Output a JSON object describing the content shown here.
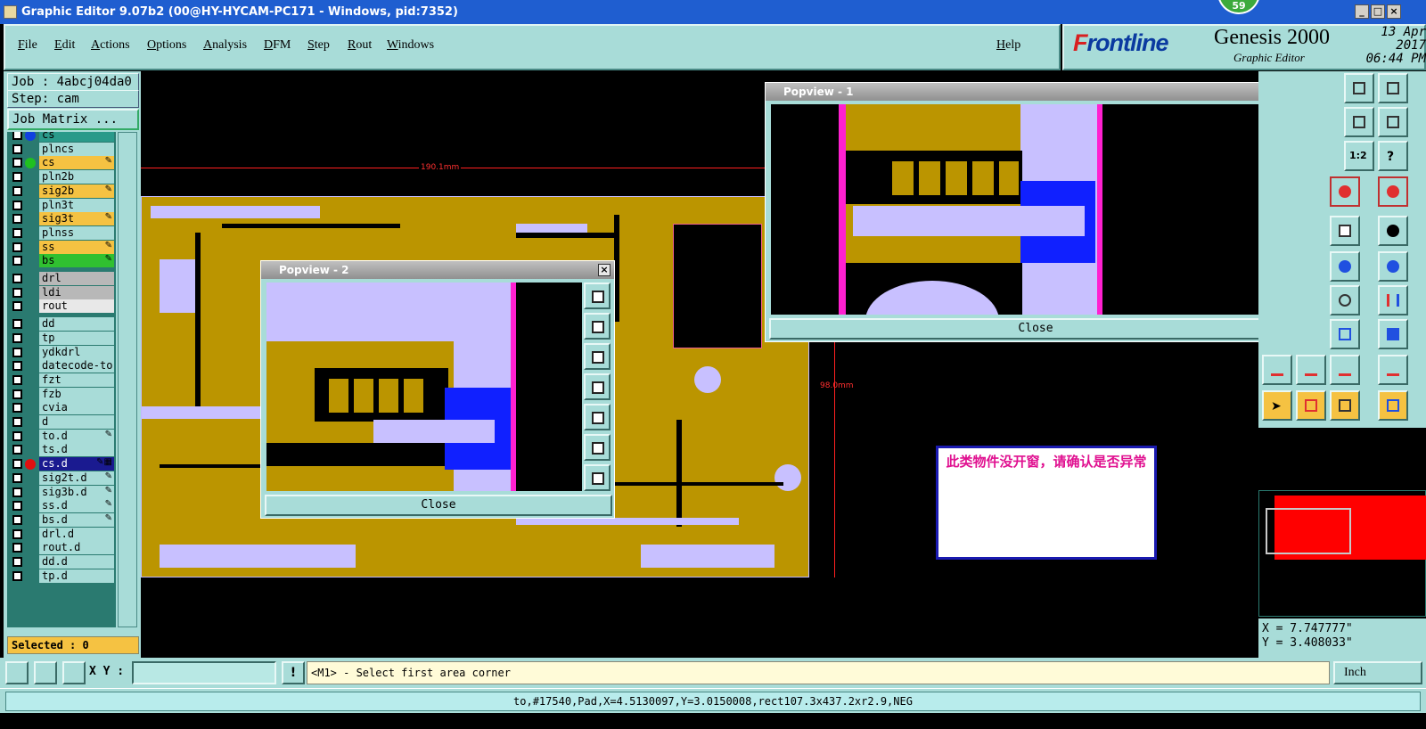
{
  "window": {
    "title": "Graphic Editor 9.07b2 (00@HY-HYCAM-PC171 - Windows, pid:7352)",
    "badge": "59"
  },
  "menu": [
    "File",
    "Edit",
    "Actions",
    "Options",
    "Analysis",
    "DFM",
    "Step",
    "Rout",
    "Windows"
  ],
  "help_label": "Help",
  "brand": {
    "logo_f": "F",
    "logo_rest": "rontline",
    "product": "Genesis 2000",
    "subtitle": "Graphic Editor",
    "date": "13 Apr 2017",
    "time": "06:44 PM"
  },
  "job": {
    "job_label": "Job : 4abcj04da0",
    "step_label": "Step: cam",
    "matrix_button": "Job Matrix ..."
  },
  "layers": [
    {
      "name": "cs",
      "color": "#2a9a8a",
      "dot": "#1040e0"
    },
    {
      "name": "plncs",
      "color": "#a8dcd8"
    },
    {
      "name": "cs",
      "color": "#f5c242",
      "dot": "#20c020",
      "mark": "✎"
    },
    {
      "name": "pln2b",
      "color": "#a8dcd8"
    },
    {
      "name": "sig2b",
      "color": "#f5c242",
      "mark": "✎"
    },
    {
      "name": "pln3t",
      "color": "#a8dcd8"
    },
    {
      "name": "sig3t",
      "color": "#f5c242",
      "mark": "✎"
    },
    {
      "name": "plnss",
      "color": "#a8dcd8"
    },
    {
      "name": "ss",
      "color": "#f5c242",
      "mark": "✎"
    },
    {
      "name": "bs",
      "color": "#30c030",
      "mark": "✎"
    },
    {
      "name": "drl",
      "color": "#b8b8b8"
    },
    {
      "name": "ldi",
      "color": "#b8b8b8"
    },
    {
      "name": "rout",
      "color": "#e8e8e8"
    },
    {
      "name": "dd",
      "color": "#a8dcd8"
    },
    {
      "name": "tp",
      "color": "#a8dcd8"
    },
    {
      "name": "ydkdrl",
      "color": "#a8dcd8"
    },
    {
      "name": "datecode-to",
      "color": "#a8dcd8"
    },
    {
      "name": "fzt",
      "color": "#a8dcd8"
    },
    {
      "name": "fzb",
      "color": "#a8dcd8"
    },
    {
      "name": "cvia",
      "color": "#a8dcd8"
    },
    {
      "name": "d",
      "color": "#a8dcd8"
    },
    {
      "name": "to.d",
      "color": "#a8dcd8",
      "mark": "✎"
    },
    {
      "name": "ts.d",
      "color": "#a8dcd8"
    },
    {
      "name": "cs.d",
      "color": "#1a1a90",
      "dot": "#e01010",
      "mark": "✎▦",
      "text": "#fff"
    },
    {
      "name": "sig2t.d",
      "color": "#a8dcd8",
      "mark": "✎"
    },
    {
      "name": "sig3b.d",
      "color": "#a8dcd8",
      "mark": "✎"
    },
    {
      "name": "ss.d",
      "color": "#a8dcd8",
      "mark": "✎"
    },
    {
      "name": "bs.d",
      "color": "#a8dcd8",
      "mark": "✎"
    },
    {
      "name": "drl.d",
      "color": "#a8dcd8"
    },
    {
      "name": "rout.d",
      "color": "#a8dcd8"
    },
    {
      "name": "dd.d",
      "color": "#a8dcd8"
    },
    {
      "name": "tp.d",
      "color": "#a8dcd8"
    }
  ],
  "selected_label": "Selected : 0",
  "dimensions": {
    "width": "190.1mm",
    "height": "98.0mm"
  },
  "message": "此类物件没开窗，请确认是否异常",
  "popview1": {
    "title": "Popview - 1",
    "close": "Close"
  },
  "popview2": {
    "title": "Popview - 2",
    "close": "Close"
  },
  "coords": {
    "x": "X = 7.747777\"",
    "y": "Y = 3.408033\""
  },
  "cmd": {
    "xy_label": "X Y :",
    "xy_value": "",
    "prompt": "<M1> - Select first area corner",
    "unit": "Inch"
  },
  "status": "to,#17540,Pad,X=4.5130097,Y=3.0150008,rect107.3x437.2xr2.9,NEG",
  "colors": {
    "accent": "#a8dcd8",
    "copper": "#bb9500",
    "pad": "#c8c0ff",
    "selected": "#f5c242"
  }
}
